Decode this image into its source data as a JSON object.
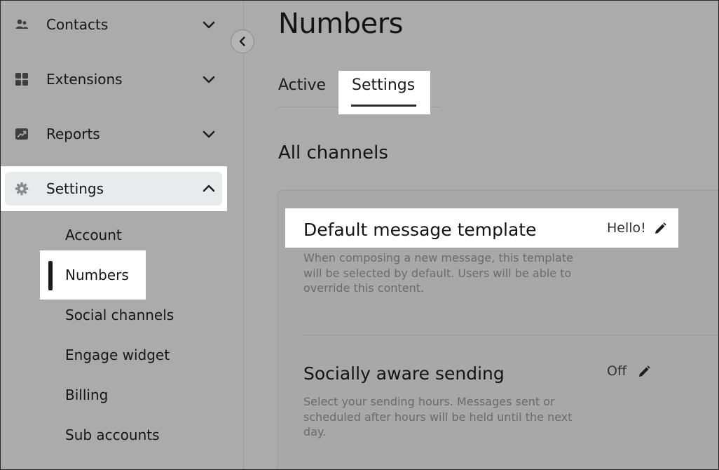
{
  "sidebar": {
    "items": [
      {
        "label": "Contacts",
        "icon": "contacts-icon"
      },
      {
        "label": "Extensions",
        "icon": "extensions-icon"
      },
      {
        "label": "Reports",
        "icon": "reports-icon"
      },
      {
        "label": "Settings",
        "icon": "gear-icon",
        "expanded": true
      }
    ],
    "settings_subitems": [
      {
        "label": "Account"
      },
      {
        "label": "Numbers",
        "selected": true
      },
      {
        "label": "Social channels"
      },
      {
        "label": "Engage widget"
      },
      {
        "label": "Billing"
      },
      {
        "label": "Sub accounts"
      }
    ]
  },
  "main": {
    "title": "Numbers",
    "tabs": [
      {
        "label": "Active"
      },
      {
        "label": "Settings",
        "selected": true
      }
    ],
    "section_title": "All channels",
    "settings": [
      {
        "title": "Default message template",
        "description": "When composing a new message, this template will be selected by default. Users will be able to override this content.",
        "value": "Hello!"
      },
      {
        "title": "Socially aware sending",
        "description": "Select your sending hours. Messages sent or scheduled after hours will be held until the next day.",
        "value": "Off"
      }
    ]
  },
  "colors": {
    "background": "#ababab",
    "highlight": "#ffffff",
    "selected_pill": "#e9eaec",
    "text": "#141414",
    "muted_text": "#6b6b6b"
  }
}
